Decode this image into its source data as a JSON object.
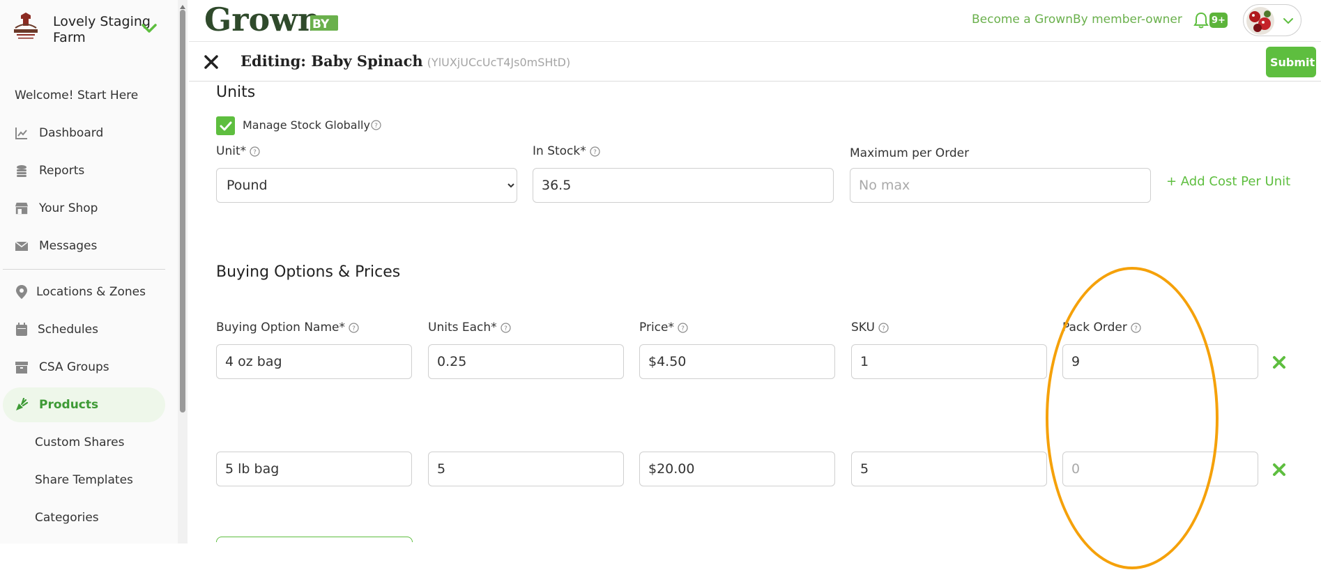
{
  "sidebar": {
    "farm_name": "Lovely Staging Farm",
    "items": [
      {
        "label": "Welcome! Start Here",
        "icon": ""
      },
      {
        "label": "Dashboard",
        "icon": "chart-line-icon"
      },
      {
        "label": "Reports",
        "icon": "coins-icon"
      },
      {
        "label": "Your Shop",
        "icon": "store-icon"
      },
      {
        "label": "Messages",
        "icon": "envelope-icon"
      },
      {
        "label": "Locations & Zones",
        "icon": "map-pin-icon"
      },
      {
        "label": "Schedules",
        "icon": "calendar-icon"
      },
      {
        "label": "CSA Groups",
        "icon": "box-icon"
      },
      {
        "label": "Products",
        "icon": "carrot-icon"
      },
      {
        "label": "Custom Shares",
        "icon": ""
      },
      {
        "label": "Share Templates",
        "icon": ""
      },
      {
        "label": "Categories",
        "icon": ""
      }
    ],
    "active_item": "Products"
  },
  "header": {
    "member_link": "Become a GrownBy member-owner",
    "notification_badge": "9+"
  },
  "edit_bar": {
    "title": "Editing: Baby Spinach",
    "product_id": "(YlUXjUCcUcT4Js0mSHtD)",
    "submit_label": "Submit"
  },
  "units": {
    "section_title": "Units",
    "manage_stock_label": "Manage Stock Globally",
    "manage_stock_checked": true,
    "unit_label": "Unit*",
    "unit_value": "Pound",
    "in_stock_label": "In Stock*",
    "in_stock_value": "36.5",
    "max_per_order_label": "Maximum per Order",
    "max_per_order_placeholder": "No max",
    "add_cost_link": "+ Add Cost Per Unit"
  },
  "buying_options": {
    "section_title": "Buying Options & Prices",
    "columns": [
      "Buying Option Name*",
      "Units Each*",
      "Price*",
      "SKU",
      "Pack Order"
    ],
    "rows": [
      {
        "name": "4 oz bag",
        "units_each": "0.25",
        "price": "$4.50",
        "sku": "1",
        "pack_order": "9",
        "pack_order_placeholder": ""
      },
      {
        "name": "5 lb bag",
        "units_each": "5",
        "price": "$20.00",
        "sku": "5",
        "pack_order": "",
        "pack_order_placeholder": "0"
      }
    ]
  },
  "colors": {
    "brand_green": "#5ebe3f",
    "logo_dark": "#2f4a2b",
    "highlight_orange": "#f5a10a"
  }
}
